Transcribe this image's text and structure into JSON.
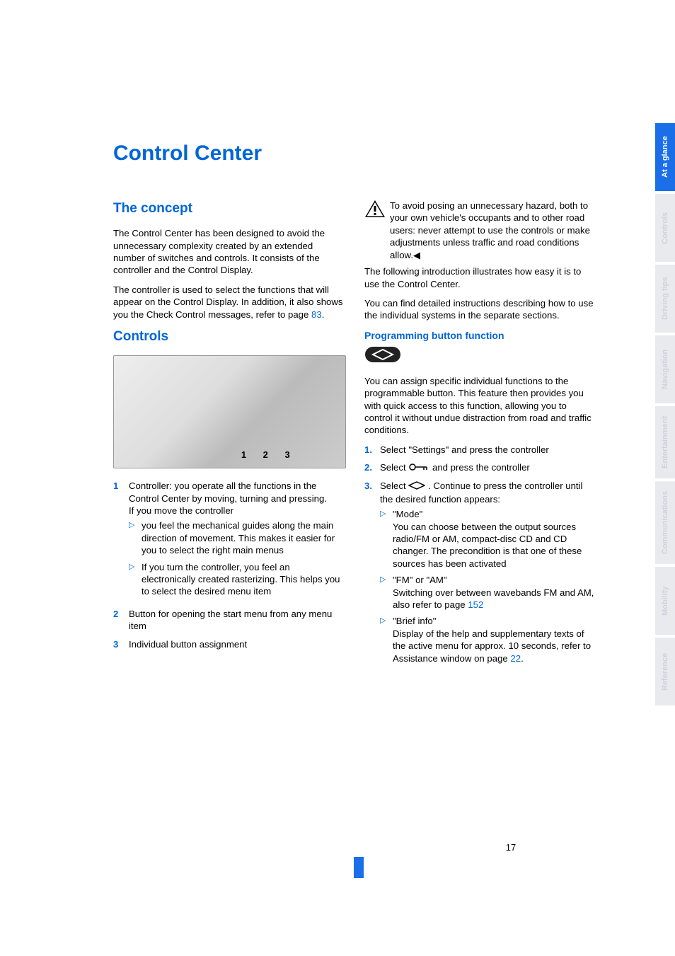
{
  "title": "Control Center",
  "page_number": "17",
  "tabs": [
    {
      "label": "At a glance",
      "active": true
    },
    {
      "label": "Controls",
      "active": false
    },
    {
      "label": "Driving tips",
      "active": false
    },
    {
      "label": "Navigation",
      "active": false
    },
    {
      "label": "Entertainment",
      "active": false
    },
    {
      "label": "Communications",
      "active": false
    },
    {
      "label": "Mobility",
      "active": false
    },
    {
      "label": "Reference",
      "active": false
    }
  ],
  "left": {
    "h_concept": "The concept",
    "p_concept_1": "The Control Center has been designed to avoid the unnecessary complexity created by an extended number of switches and controls. It consists of the controller and the Control Display.",
    "p_concept_2a": "The controller is used to select the functions that will appear on the Control Display. In addition, it also shows you the Check Control messages, refer to page ",
    "p_concept_2_ref": "83",
    "p_concept_2b": ".",
    "h_controls": "Controls",
    "callouts": "1  2  3",
    "items": [
      {
        "n": "1",
        "text": "Controller: you operate all the functions in the Control Center by moving, turning and pressing.",
        "text2": "If you move the controller",
        "subs": [
          "you feel the mechanical guides along the main direction of movement. This makes it easier for you to select the right main menus",
          "If you turn the controller, you feel an electronically created rasterizing. This helps you to select the desired menu item"
        ]
      },
      {
        "n": "2",
        "text": "Button for opening the start menu from any menu item"
      },
      {
        "n": "3",
        "text": "Individual button assignment"
      }
    ]
  },
  "right": {
    "warn": "To avoid posing an unnecessary hazard, both to your own vehicle's occupants and to other road users: never attempt to use the controls or make adjustments unless traffic and road conditions allow.",
    "p_after_warn_1": "The following introduction illustrates how easy it is to use the Control Center.",
    "p_after_warn_2": "You can find detailed instructions describing how to use the individual systems in the separate sections.",
    "h_prog": "Programming button function",
    "p_prog": "You can assign specific individual functions to the programmable button. This feature then provides you with quick access to this function, allowing you to control it without undue distraction from road and traffic conditions.",
    "steps": [
      {
        "n": "1.",
        "text": "Select \"Settings\" and press the controller"
      },
      {
        "n": "2.",
        "pre": "Select ",
        "icon": "key",
        "post": " and press the controller"
      },
      {
        "n": "3.",
        "pre": "Select ",
        "icon": "diamond",
        "post": ". Continue to press the controller until the desired function appears:"
      }
    ],
    "options": [
      {
        "title": "\"Mode\"",
        "body": "You can choose between the output sources radio/FM or AM, compact-disc CD and CD changer. The precondition is that one of these sources has been activated"
      },
      {
        "title": "\"FM\" or \"AM\"",
        "body_a": "Switching over between wavebands FM and AM, also refer to page ",
        "ref": "152"
      },
      {
        "title": "\"Brief info\"",
        "body_a": "Display of the help and supplementary texts of the active menu for approx. 10 seconds, refer to Assistance window on page ",
        "ref": "22",
        "body_b": "."
      }
    ]
  }
}
